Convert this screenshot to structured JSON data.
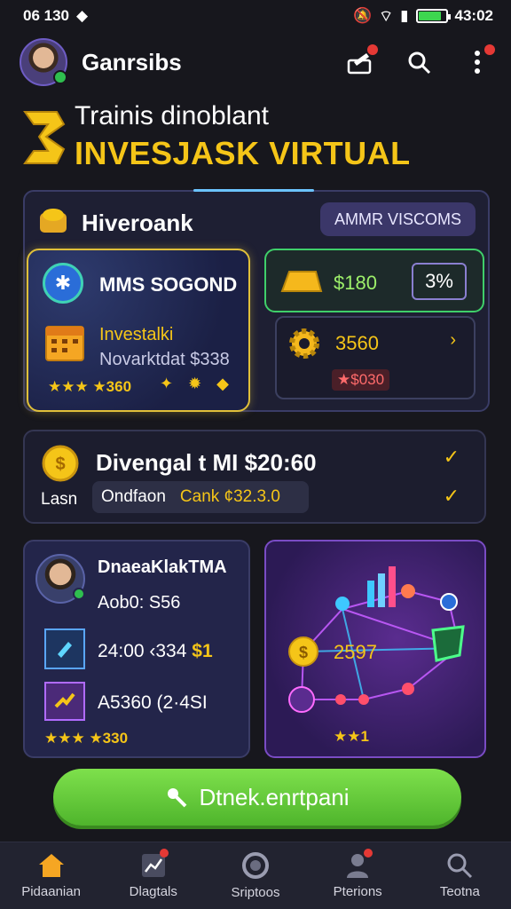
{
  "status": {
    "left_text": "06 130",
    "time": "43:02",
    "battery_percent": 85
  },
  "appbar": {
    "username": "Ganrsibs"
  },
  "hero": {
    "subtitle": "Trainis dinoblant",
    "title": "INVESJASK VIRTUAL"
  },
  "panel": {
    "title": "Hiveroank",
    "chip": "AMMR VISCOMS"
  },
  "card_yellow": {
    "title": "MMS SOGOND",
    "line1": "Investalki",
    "line2": "Novarktdat $338",
    "stars": "★★★ ★360"
  },
  "card_green": {
    "value": "$180",
    "percent": "3%"
  },
  "card_dark": {
    "value": "3560",
    "badge": "★$030"
  },
  "row_card": {
    "title": "Divengal t MI $20:60",
    "label": "Lasn",
    "pill_a": "Ondfaon",
    "pill_b": "Cank ¢32.3.0"
  },
  "profile_card": {
    "name": "DnaeaKlakTMA",
    "sub": "Aob0: S56",
    "value1": "24:00 ‹334",
    "value1_accent": "$1",
    "value2": "A5360 (2·4SI",
    "stars": "★★★ ★330"
  },
  "network_card": {
    "value": "2597",
    "stars": "★★1"
  },
  "cta": {
    "label": "Dtnek.enrtpani"
  },
  "bottom_nav": [
    {
      "label": "Pidaanian",
      "icon": "home-icon"
    },
    {
      "label": "Dlagtals",
      "icon": "chart-icon"
    },
    {
      "label": "Sriptoos",
      "icon": "circle-icon"
    },
    {
      "label": "Pterions",
      "icon": "person-icon"
    },
    {
      "label": "Teotna",
      "icon": "search-icon"
    }
  ],
  "colors": {
    "accent_gold": "#f5c518",
    "accent_green": "#5cc93a",
    "background": "#17171d"
  }
}
